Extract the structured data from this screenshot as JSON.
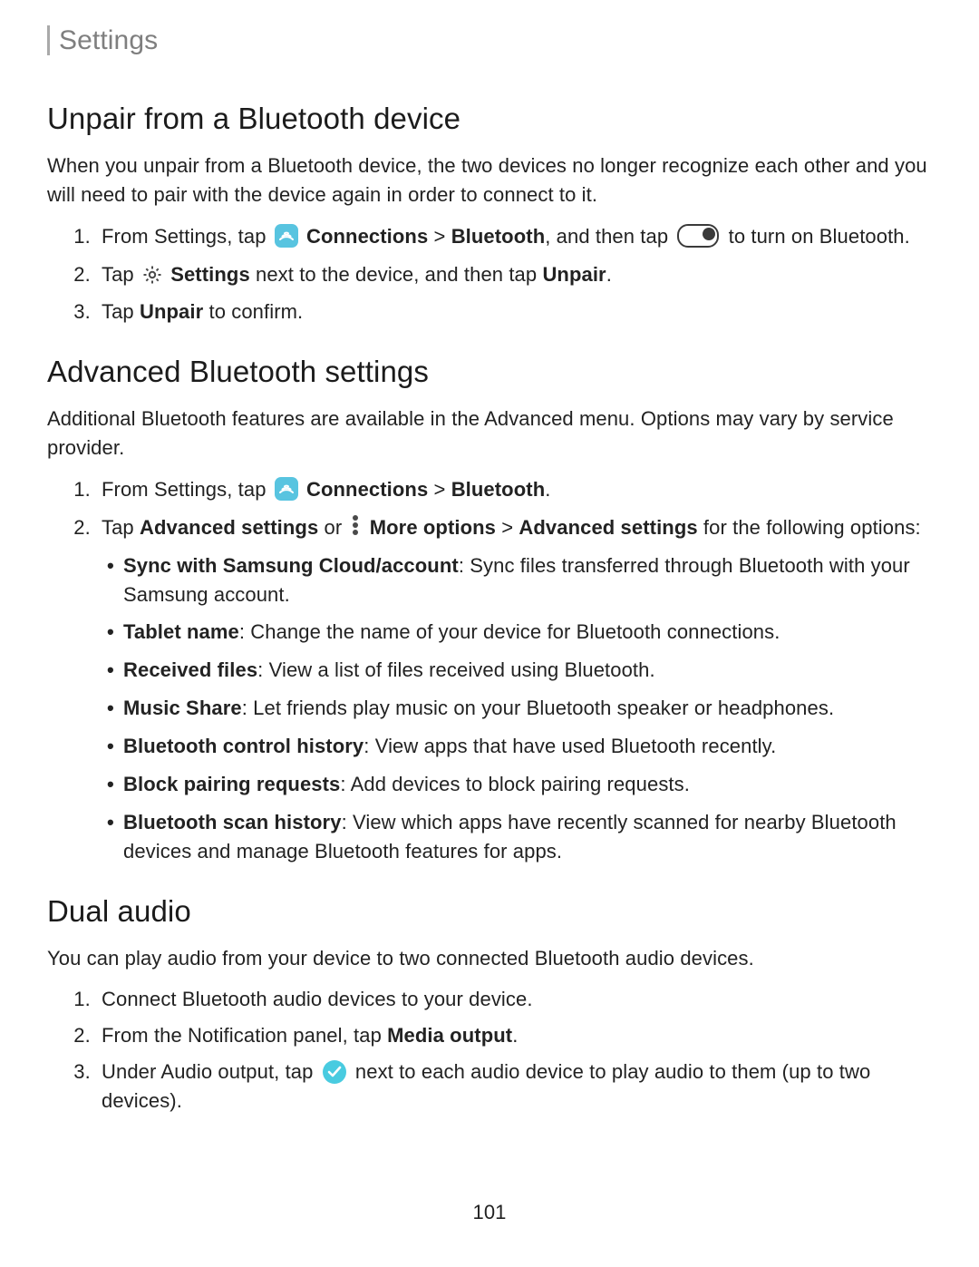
{
  "page": {
    "running_head": "Settings",
    "number": "101"
  },
  "sections": {
    "unpair": {
      "title": "Unpair from a Bluetooth device",
      "intro": "When you unpair from a Bluetooth device, the two devices no longer recognize each other and you will need to pair with the device again in order to connect to it.",
      "step1_a": "From Settings, tap ",
      "step1_conn": "Connections",
      "step1_sep": " > ",
      "step1_bt": "Bluetooth",
      "step1_b": ", and then tap ",
      "step1_c": " to turn on Bluetooth.",
      "step2_a": "Tap ",
      "step2_settings": "Settings",
      "step2_b": " next to the device, and then tap ",
      "step2_unpair": "Unpair",
      "step2_c": ".",
      "step3_a": "Tap ",
      "step3_unpair": "Unpair",
      "step3_b": " to confirm."
    },
    "advanced": {
      "title": "Advanced Bluetooth settings",
      "intro": "Additional Bluetooth features are available in the Advanced menu. Options may vary by service provider.",
      "step1_a": "From Settings, tap ",
      "step1_conn": "Connections",
      "step1_sep": " > ",
      "step1_bt": "Bluetooth",
      "step1_c": ".",
      "step2_a": "Tap ",
      "step2_adv1": "Advanced settings",
      "step2_b": " or ",
      "step2_more": "More options",
      "step2_sep": " > ",
      "step2_adv2": "Advanced settings",
      "step2_c": " for the following options:",
      "opts": [
        {
          "term": "Sync with Samsung Cloud/account",
          "desc": ": Sync files transferred through Bluetooth with your Samsung account."
        },
        {
          "term": "Tablet name",
          "desc": ": Change the name of your device for Bluetooth connections."
        },
        {
          "term": "Received files",
          "desc": ": View a list of files received using Bluetooth."
        },
        {
          "term": "Music Share",
          "desc": ": Let friends play music on your Bluetooth speaker or headphones."
        },
        {
          "term": "Bluetooth control history",
          "desc": ": View apps that have used Bluetooth recently."
        },
        {
          "term": "Block pairing requests",
          "desc": ": Add devices to block pairing requests."
        },
        {
          "term": "Bluetooth scan history",
          "desc": ": View which apps have recently scanned for nearby Bluetooth devices and manage Bluetooth features for apps."
        }
      ]
    },
    "dual": {
      "title": "Dual audio",
      "intro": "You can play audio from your device to two connected Bluetooth audio devices.",
      "step1": "Connect Bluetooth audio devices to your device.",
      "step2_a": "From the Notification panel, tap ",
      "step2_media": "Media output",
      "step2_b": ".",
      "step3_a": "Under Audio output, tap ",
      "step3_b": " next to each audio device to play audio to them (up to two devices)."
    }
  }
}
